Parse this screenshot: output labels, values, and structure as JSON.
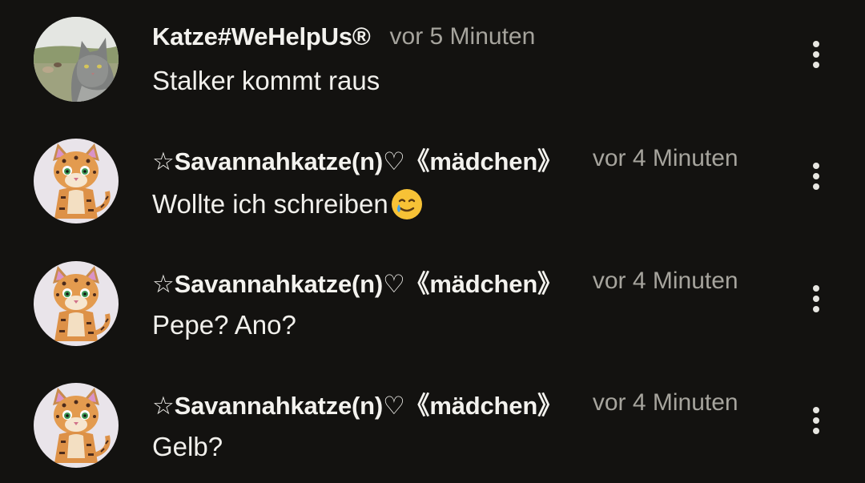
{
  "comments": [
    {
      "author": "Katze#WeHelpUs®",
      "time": "vor 5 Minuten",
      "text": "Stalker kommt raus",
      "avatar": "gray-cat-photo",
      "emoji": "",
      "menu_icon": "more-vertical-icon"
    },
    {
      "author": "☆Savannahkatze(n)♡《mädchen》",
      "time": "vor 4 Minuten",
      "text": "Wollte ich schreiben",
      "avatar": "cartoon-leopard-cat",
      "emoji": "smiling-face-with-tear-emoji",
      "menu_icon": "more-vertical-icon"
    },
    {
      "author": "☆Savannahkatze(n)♡《mädchen》",
      "time": "vor 4 Minuten",
      "text": "Pepe? Ano?",
      "avatar": "cartoon-leopard-cat",
      "emoji": "",
      "menu_icon": "more-vertical-icon"
    },
    {
      "author": "☆Savannahkatze(n)♡《mädchen》",
      "time": "vor 4 Minuten",
      "text": "Gelb?",
      "avatar": "cartoon-leopard-cat",
      "emoji": "",
      "menu_icon": "more-vertical-icon"
    }
  ],
  "colors": {
    "background": "#131210",
    "text": "#f1f0ec",
    "timestamp": "#a6a49d"
  }
}
